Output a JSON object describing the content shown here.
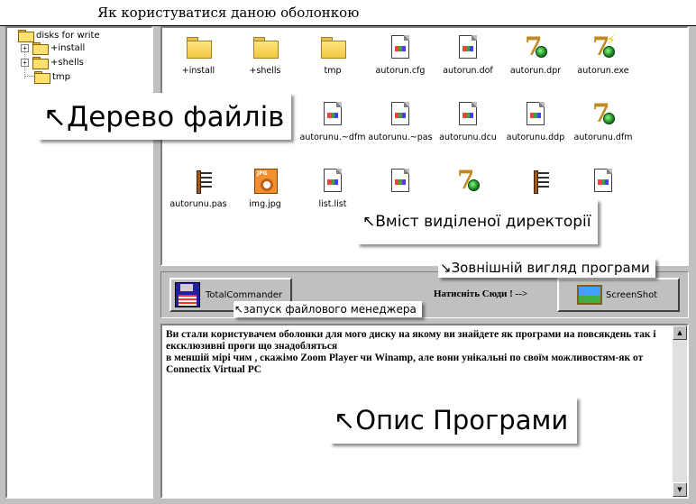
{
  "window": {
    "title": "Як користуватися даною оболонкою"
  },
  "tree": {
    "root": "disks for write",
    "items": [
      {
        "label": "+install",
        "expander": "+"
      },
      {
        "label": "+shells",
        "expander": "+"
      },
      {
        "label": "tmp",
        "expander": ""
      }
    ]
  },
  "files": [
    {
      "name": "+install",
      "icon": "folder-icon"
    },
    {
      "name": "+shells",
      "icon": "folder-icon"
    },
    {
      "name": "tmp",
      "icon": "folder-icon"
    },
    {
      "name": "autorun.cfg",
      "icon": "document-icon"
    },
    {
      "name": "autorun.dof",
      "icon": "document-icon"
    },
    {
      "name": "autorun.dpr",
      "icon": "delphi-project-icon"
    },
    {
      "name": "autorun.exe",
      "icon": "delphi-exe-icon"
    },
    {
      "name": "autorunu.~dfm",
      "icon": "document-icon"
    },
    {
      "name": "autorunu.~pas",
      "icon": "document-icon"
    },
    {
      "name": "autorunu.dcu",
      "icon": "document-icon"
    },
    {
      "name": "autorunu.ddp",
      "icon": "document-icon"
    },
    {
      "name": "autorunu.dfm",
      "icon": "delphi-project-icon"
    },
    {
      "name": "autorunu.pas",
      "icon": "pascal-source-icon"
    },
    {
      "name": "img.jpg",
      "icon": "jpeg-image-icon"
    },
    {
      "name": "list.list",
      "icon": "document-icon"
    },
    {
      "name": "",
      "icon": "document-icon"
    },
    {
      "name": "",
      "icon": "delphi-project-icon"
    },
    {
      "name": "",
      "icon": "pascal-source-icon"
    },
    {
      "name": "",
      "icon": "document-icon"
    }
  ],
  "callouts": {
    "tree": "↖Дерево файлів",
    "content": "↖Вміст виділеної директорії",
    "look": "↘Зовнішній вигляд програми",
    "launch": "↖запуск файлового менеджера",
    "desc": "↖Опис Програми"
  },
  "buttons": {
    "total_commander": "TotalCommander",
    "click_here": "Натисніть Сюди ! -->",
    "screenshot": "ScreenShot"
  },
  "description": {
    "text": "Ви стали користувачем оболонки для мого диску на якому ви знайдете як програми на повсякдень так і ексклюзивні проги що знадобляться\nв меншій мірі чим , скажімо Zoom Player  чи Winamp, але вони унікальні по своїм можливостям-як от Connectix Virtual PC"
  },
  "colors": {
    "folder": "#ffe070",
    "callout_bg": "#ffffff",
    "panel": "#c0c0c0"
  }
}
